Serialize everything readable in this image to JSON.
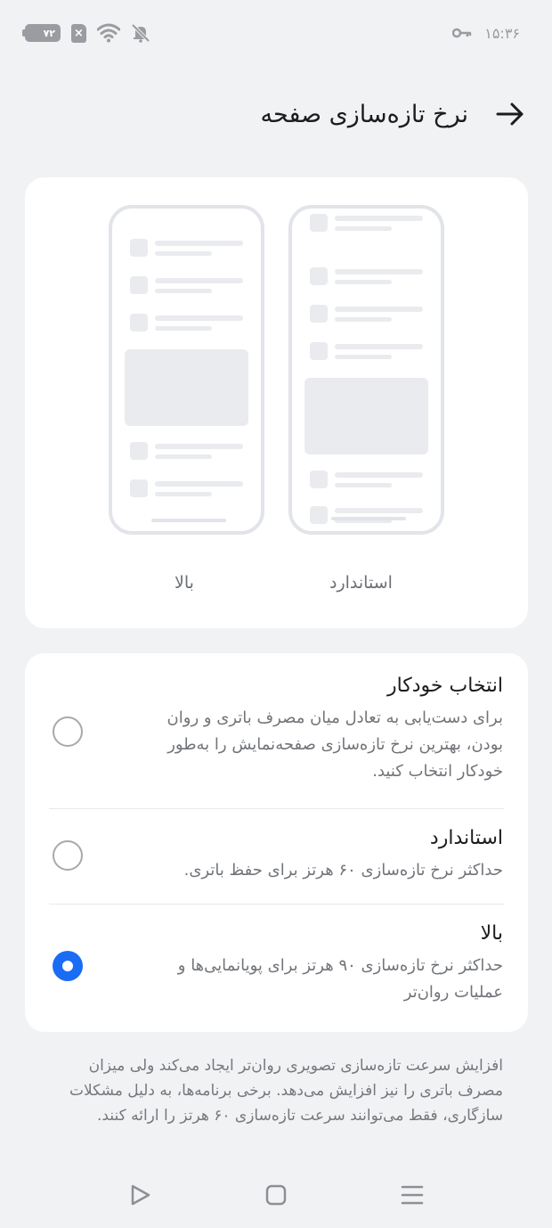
{
  "status_bar": {
    "battery": "۷۲",
    "sim": "×",
    "time": "۱۵:۳۶",
    "icons": [
      "battery-icon",
      "sim-icon",
      "wifi-icon",
      "bell-muted-icon",
      "key-icon"
    ]
  },
  "header": {
    "title": "نرخ تازه‌سازی صفحه",
    "back_icon": "arrow-back-icon"
  },
  "preview": {
    "left_label": "بالا",
    "right_label": "استاندارد"
  },
  "options": [
    {
      "title": "انتخاب خودکار",
      "lines": [
        "برای دست‌یابی به تعادل میان مصرف باتری و روان",
        "بودن، بهترین نرخ تازه‌سازی صفحه‌نمایش را به‌طور",
        "خودکار انتخاب کنید."
      ],
      "selected": false
    },
    {
      "title": "استاندارد",
      "lines": [
        "حداکثر نرخ تازه‌سازی ۶۰ هرتز برای حفظ باتری."
      ],
      "selected": false
    },
    {
      "title": "بالا",
      "lines": [
        "حداکثر نرخ تازه‌سازی ۹۰ هرتز برای پویانمایی‌ها و",
        "عملیات روان‌تر"
      ],
      "selected": true
    }
  ],
  "footnote_lines": [
    "افزایش سرعت تازه‌سازی تصویری روان‌تر ایجاد می‌کند ولی میزان",
    "مصرف باتری را نیز افزایش می‌دهد. برخی برنامه‌ها، به دلیل مشکلات",
    "سازگاری، فقط می‌توانند سرعت تازه‌سازی ۶۰ هرتز را ارائه کنند."
  ],
  "nav": [
    "back-icon",
    "home-icon",
    "menu-icon"
  ],
  "colors": {
    "accent": "#1a6cf5",
    "background": "#f1f2f4",
    "card": "#ffffff"
  }
}
